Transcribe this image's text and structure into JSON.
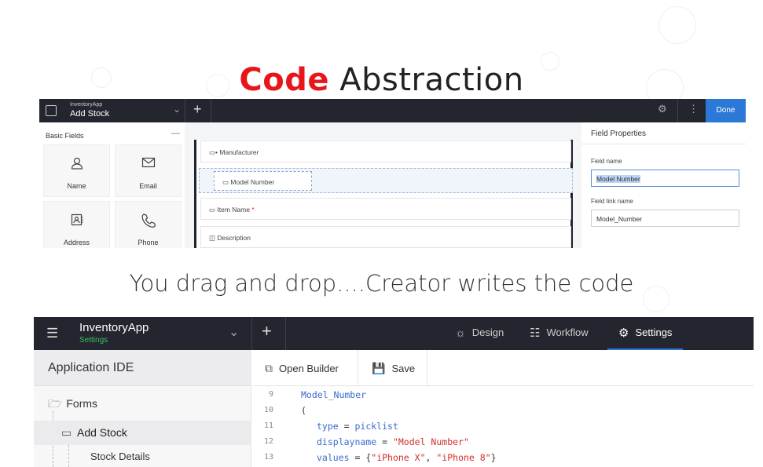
{
  "title": {
    "highlight": "Code",
    "rest": "Abstraction"
  },
  "subtitle": "You drag and drop....Creator writes the code",
  "builder": {
    "app_name": "InventoryApp",
    "page_name": "Add Stock",
    "done_label": "Done",
    "basic_fields_title": "Basic Fields",
    "tiles": [
      {
        "label": "Name",
        "icon": "person-icon"
      },
      {
        "label": "Email",
        "icon": "envelope-icon"
      },
      {
        "label": "Address",
        "icon": "address-card-icon"
      },
      {
        "label": "Phone",
        "icon": "phone-icon"
      }
    ],
    "form_fields": [
      "Manufacturer",
      "Model Number",
      "Item Name",
      "Description"
    ],
    "required_marker": "*",
    "properties": {
      "title": "Field Properties",
      "field_name_label": "Field name",
      "field_name_value": "Model Number",
      "field_link_label": "Field link name",
      "field_link_value": "Model_Number"
    }
  },
  "ide": {
    "app_name": "InventoryApp",
    "app_sub": "Settings",
    "nav": [
      {
        "label": "Design",
        "icon": "palette-icon"
      },
      {
        "label": "Workflow",
        "icon": "workflow-icon"
      },
      {
        "label": "Settings",
        "icon": "gear-icon"
      }
    ],
    "sidebar_title": "Application IDE",
    "forms_label": "Forms",
    "add_stock_label": "Add Stock",
    "stock_details_label": "Stock Details",
    "open_builder_label": "Open Builder",
    "save_label": "Save",
    "code_lines": [
      {
        "num": "9",
        "text": "Model_Number"
      },
      {
        "num": "10",
        "text": "("
      },
      {
        "num": "11",
        "key": "type",
        "op": " = ",
        "val": "picklist"
      },
      {
        "num": "12",
        "key": "displayname",
        "op": " = ",
        "str": "\"Model Number\""
      },
      {
        "num": "13",
        "key": "values",
        "op": " = ",
        "pre": "{",
        "s1": "\"iPhone X\"",
        "mid": ", ",
        "s2": "\"iPhone 8\"",
        "post": "}"
      }
    ]
  },
  "colors": {
    "accent": "#e8161b",
    "header": "#23262f",
    "primary": "#2c78d6"
  }
}
